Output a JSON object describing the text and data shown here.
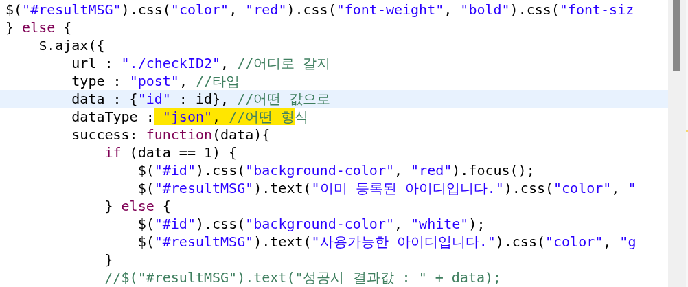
{
  "editor": {
    "lines": [
      {
        "current": false,
        "tokens": [
          {
            "kind": "plain",
            "text": "$("
          },
          {
            "kind": "string",
            "text": "\"#resultMSG\""
          },
          {
            "kind": "plain",
            "text": ").css("
          },
          {
            "kind": "string",
            "text": "\"color\""
          },
          {
            "kind": "plain",
            "text": ", "
          },
          {
            "kind": "string",
            "text": "\"red\""
          },
          {
            "kind": "plain",
            "text": ").css("
          },
          {
            "kind": "string",
            "text": "\"font-weight\""
          },
          {
            "kind": "plain",
            "text": ", "
          },
          {
            "kind": "string",
            "text": "\"bold\""
          },
          {
            "kind": "plain",
            "text": ").css("
          },
          {
            "kind": "string",
            "text": "\"font-siz"
          }
        ]
      },
      {
        "current": false,
        "tokens": [
          {
            "kind": "plain",
            "text": "} "
          },
          {
            "kind": "keyword",
            "text": "else"
          },
          {
            "kind": "plain",
            "text": " {"
          }
        ]
      },
      {
        "current": false,
        "tokens": [
          {
            "kind": "plain",
            "text": "    $.ajax({"
          }
        ]
      },
      {
        "current": false,
        "tokens": [
          {
            "kind": "plain",
            "text": "        url : "
          },
          {
            "kind": "string",
            "text": "\"./checkID2\""
          },
          {
            "kind": "plain",
            "text": ", "
          },
          {
            "kind": "comment",
            "text": "//어디로 갈지"
          }
        ]
      },
      {
        "current": false,
        "tokens": [
          {
            "kind": "plain",
            "text": "        type : "
          },
          {
            "kind": "string",
            "text": "\"post\""
          },
          {
            "kind": "plain",
            "text": ", "
          },
          {
            "kind": "comment",
            "text": "//타입"
          }
        ]
      },
      {
        "current": true,
        "tokens": [
          {
            "kind": "plain",
            "text": "        data : {"
          },
          {
            "kind": "string",
            "text": "\"id\""
          },
          {
            "kind": "plain",
            "text": " : id}, "
          },
          {
            "kind": "comment",
            "text": "//어떤 값으로"
          }
        ]
      },
      {
        "current": false,
        "tokens": [
          {
            "kind": "plain",
            "text": "        dataType :"
          },
          {
            "kind": "string",
            "text": " \"json\"",
            "highlighted": true
          },
          {
            "kind": "plain",
            "text": ", ",
            "highlighted": true
          },
          {
            "kind": "comment",
            "text": "//어떤 형",
            "highlighted": true
          },
          {
            "kind": "comment",
            "text": "식"
          }
        ]
      },
      {
        "current": false,
        "tokens": [
          {
            "kind": "plain",
            "text": "        success: "
          },
          {
            "kind": "keyword",
            "text": "function"
          },
          {
            "kind": "plain",
            "text": "(data){"
          }
        ]
      },
      {
        "current": false,
        "tokens": [
          {
            "kind": "keyword",
            "text": "            if"
          },
          {
            "kind": "plain",
            "text": " (data == 1) {"
          }
        ]
      },
      {
        "current": false,
        "tokens": [
          {
            "kind": "plain",
            "text": "                $("
          },
          {
            "kind": "string",
            "text": "\"#id\""
          },
          {
            "kind": "plain",
            "text": ").css("
          },
          {
            "kind": "string",
            "text": "\"background-color\""
          },
          {
            "kind": "plain",
            "text": ", "
          },
          {
            "kind": "string",
            "text": "\"red\""
          },
          {
            "kind": "plain",
            "text": ").focus();"
          }
        ]
      },
      {
        "current": false,
        "tokens": [
          {
            "kind": "plain",
            "text": "                $("
          },
          {
            "kind": "string",
            "text": "\"#resultMSG\""
          },
          {
            "kind": "plain",
            "text": ").text("
          },
          {
            "kind": "string",
            "text": "\"이미 등록된 아이디입니다.\""
          },
          {
            "kind": "plain",
            "text": ").css("
          },
          {
            "kind": "string",
            "text": "\"color\""
          },
          {
            "kind": "plain",
            "text": ", "
          },
          {
            "kind": "string",
            "text": "\""
          }
        ]
      },
      {
        "current": false,
        "tokens": [
          {
            "kind": "plain",
            "text": "            } "
          },
          {
            "kind": "keyword",
            "text": "else"
          },
          {
            "kind": "plain",
            "text": " {"
          }
        ]
      },
      {
        "current": false,
        "tokens": [
          {
            "kind": "plain",
            "text": "                $("
          },
          {
            "kind": "string",
            "text": "\"#id\""
          },
          {
            "kind": "plain",
            "text": ").css("
          },
          {
            "kind": "string",
            "text": "\"background-color\""
          },
          {
            "kind": "plain",
            "text": ", "
          },
          {
            "kind": "string",
            "text": "\"white\""
          },
          {
            "kind": "plain",
            "text": ");"
          }
        ]
      },
      {
        "current": false,
        "tokens": [
          {
            "kind": "plain",
            "text": "                $("
          },
          {
            "kind": "string",
            "text": "\"#resultMSG\""
          },
          {
            "kind": "plain",
            "text": ").text("
          },
          {
            "kind": "string",
            "text": "\"사용가능한 아이디입니다.\""
          },
          {
            "kind": "plain",
            "text": ").css("
          },
          {
            "kind": "string",
            "text": "\"color\""
          },
          {
            "kind": "plain",
            "text": ", "
          },
          {
            "kind": "string",
            "text": "\"g"
          }
        ]
      },
      {
        "current": false,
        "tokens": [
          {
            "kind": "plain",
            "text": "            }"
          }
        ]
      },
      {
        "current": false,
        "tokens": [
          {
            "kind": "comment",
            "text": "            //$(\"#resultMSG\").text(\"성공시 결과값 : \" + data);"
          }
        ]
      }
    ]
  }
}
